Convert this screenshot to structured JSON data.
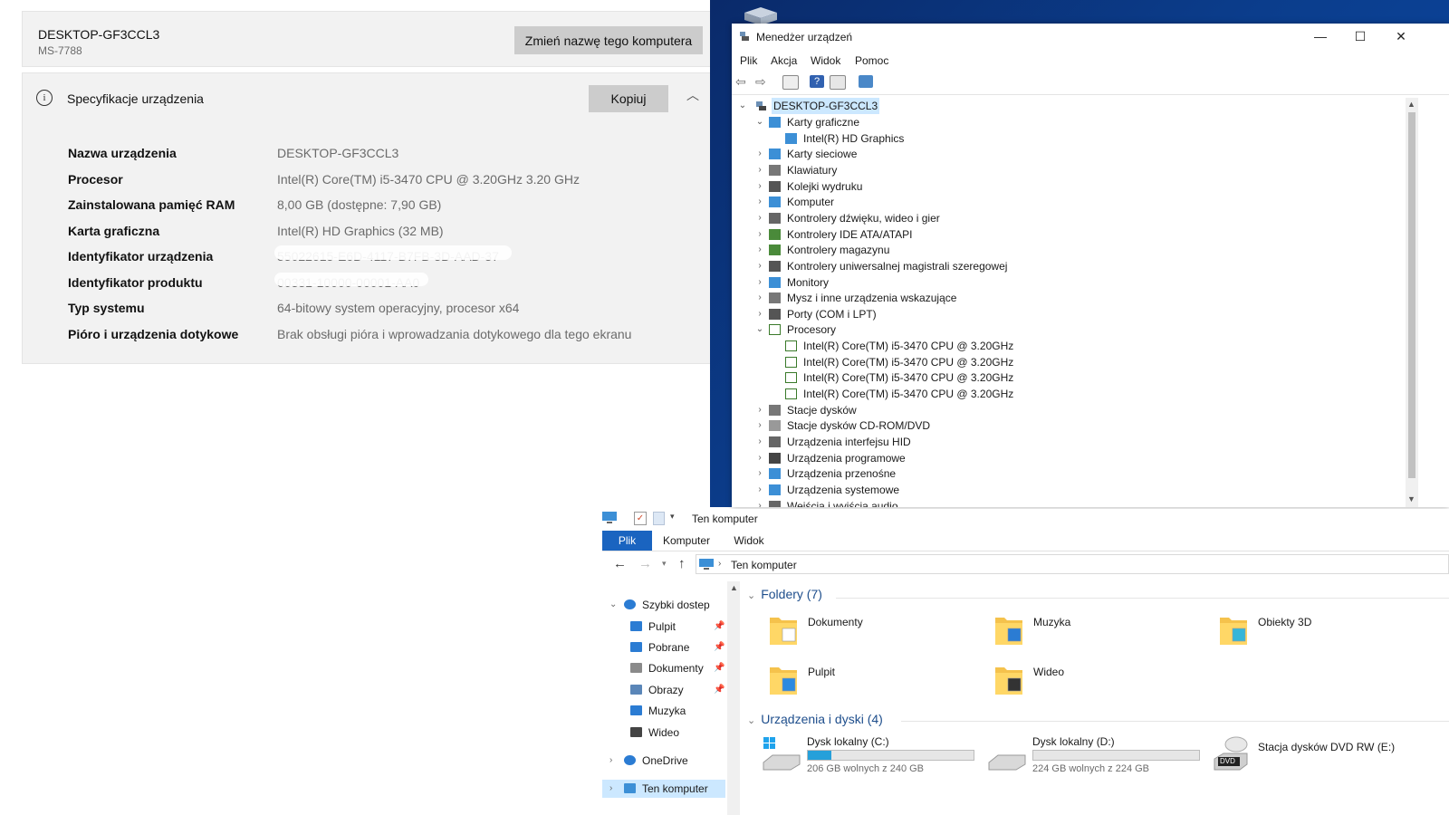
{
  "about": {
    "device_name": "DESKTOP-GF3CCL3",
    "model": "MS-7788",
    "rename_button": "Zmień nazwę tego komputera",
    "spec_title": "Specyfikacje urządzenia",
    "copy_button": "Kopiuj",
    "info_icon": "info-icon",
    "specs": [
      {
        "key": "Nazwa urządzenia",
        "value": "DESKTOP-GF3CCL3"
      },
      {
        "key": "Procesor",
        "value": "Intel(R) Core(TM) i5-3470 CPU @ 3.20GHz   3.20 GHz"
      },
      {
        "key": "Zainstalowana pamięć RAM",
        "value": "8,00 GB (dostępne: 7,90 GB)"
      },
      {
        "key": "Karta graficzna",
        "value": "Intel(R) HD Graphics (32 MB)"
      },
      {
        "key": "Identyfikator urządzenia",
        "value": "55022615-E6D-4117-B7FB-3D-AAD-37"
      },
      {
        "key": "Identyfikator produktu",
        "value": "00331-10000-00001-AA0"
      },
      {
        "key": "Typ systemu",
        "value": "64-bitowy system operacyjny, procesor x64"
      },
      {
        "key": "Pióro i urządzenia dotykowe",
        "value": "Brak obsługi pióra i wprowadzania dotykowego dla tego ekranu"
      }
    ]
  },
  "devmgr": {
    "title": "Menedżer urządzeń",
    "menu": [
      "Plik",
      "Akcja",
      "Widok",
      "Pomoc"
    ],
    "window_controls": [
      "—",
      "☐",
      "✕"
    ],
    "root": "DESKTOP-GF3CCL3",
    "tree": [
      {
        "label": "Karty graficzne",
        "level": 1,
        "expanded": true,
        "icon": "display-adapter-icon",
        "color": "#3c8fd6"
      },
      {
        "label": "Intel(R) HD Graphics",
        "level": 2,
        "icon": "display-adapter-icon",
        "color": "#3c8fd6"
      },
      {
        "label": "Karty sieciowe",
        "level": 1,
        "expanded": false,
        "icon": "network-adapter-icon",
        "color": "#3c8fd6"
      },
      {
        "label": "Klawiatury",
        "level": 1,
        "expanded": false,
        "icon": "keyboard-icon",
        "color": "#777777"
      },
      {
        "label": "Kolejki wydruku",
        "level": 1,
        "expanded": false,
        "icon": "printer-icon",
        "color": "#555555"
      },
      {
        "label": "Komputer",
        "level": 1,
        "expanded": false,
        "icon": "computer-icon",
        "color": "#3c8fd6"
      },
      {
        "label": "Kontrolery dźwięku, wideo i gier",
        "level": 1,
        "expanded": false,
        "icon": "speaker-icon",
        "color": "#666666"
      },
      {
        "label": "Kontrolery IDE ATA/ATAPI",
        "level": 1,
        "expanded": false,
        "icon": "ide-controller-icon",
        "color": "#4a8a3a"
      },
      {
        "label": "Kontrolery magazynu",
        "level": 1,
        "expanded": false,
        "icon": "storage-controller-icon",
        "color": "#4a8a3a"
      },
      {
        "label": "Kontrolery uniwersalnej magistrali szeregowej",
        "level": 1,
        "expanded": false,
        "icon": "usb-icon",
        "color": "#555555"
      },
      {
        "label": "Monitory",
        "level": 1,
        "expanded": false,
        "icon": "monitor-icon",
        "color": "#3c8fd6"
      },
      {
        "label": "Mysz i inne urządzenia wskazujące",
        "level": 1,
        "expanded": false,
        "icon": "mouse-icon",
        "color": "#777777"
      },
      {
        "label": "Porty (COM i LPT)",
        "level": 1,
        "expanded": false,
        "icon": "port-icon",
        "color": "#555555"
      },
      {
        "label": "Procesory",
        "level": 1,
        "expanded": true,
        "icon": "processor-icon",
        "color": "#3a7a2a"
      },
      {
        "label": "Intel(R) Core(TM) i5-3470 CPU @ 3.20GHz",
        "level": 2,
        "icon": "processor-icon",
        "color": "#3a7a2a"
      },
      {
        "label": "Intel(R) Core(TM) i5-3470 CPU @ 3.20GHz",
        "level": 2,
        "icon": "processor-icon",
        "color": "#3a7a2a"
      },
      {
        "label": "Intel(R) Core(TM) i5-3470 CPU @ 3.20GHz",
        "level": 2,
        "icon": "processor-icon",
        "color": "#3a7a2a"
      },
      {
        "label": "Intel(R) Core(TM) i5-3470 CPU @ 3.20GHz",
        "level": 2,
        "icon": "processor-icon",
        "color": "#3a7a2a"
      },
      {
        "label": "Stacje dysków",
        "level": 1,
        "expanded": false,
        "icon": "disk-drive-icon",
        "color": "#777777"
      },
      {
        "label": "Stacje dysków CD-ROM/DVD",
        "level": 1,
        "expanded": false,
        "icon": "cd-drive-icon",
        "color": "#999999"
      },
      {
        "label": "Urządzenia interfejsu HID",
        "level": 1,
        "expanded": false,
        "icon": "hid-icon",
        "color": "#666666"
      },
      {
        "label": "Urządzenia programowe",
        "level": 1,
        "expanded": false,
        "icon": "software-device-icon",
        "color": "#444444"
      },
      {
        "label": "Urządzenia przenośne",
        "level": 1,
        "expanded": false,
        "icon": "portable-device-icon",
        "color": "#3c8fd6"
      },
      {
        "label": "Urządzenia systemowe",
        "level": 1,
        "expanded": false,
        "icon": "system-device-icon",
        "color": "#3c8fd6"
      },
      {
        "label": "Wejścia i wyjścia audio",
        "level": 1,
        "expanded": false,
        "icon": "audio-io-icon",
        "color": "#666666"
      }
    ]
  },
  "explorer": {
    "title": "Ten komputer",
    "tabs": [
      "Plik",
      "Komputer",
      "Widok"
    ],
    "address": "Ten komputer",
    "nav": [
      {
        "label": "Szybki dostep",
        "level": 0,
        "icon": "star-icon",
        "color": "#2b7cd3",
        "pinned": false,
        "chevron": "v"
      },
      {
        "label": "Pulpit",
        "level": 1,
        "icon": "desktop-icon",
        "color": "#2b7cd3",
        "pinned": true
      },
      {
        "label": "Pobrane",
        "level": 1,
        "icon": "download-icon",
        "color": "#2b7cd3",
        "pinned": true
      },
      {
        "label": "Dokumenty",
        "level": 1,
        "icon": "document-icon",
        "color": "#8a8a8a",
        "pinned": true
      },
      {
        "label": "Obrazy",
        "level": 1,
        "icon": "pictures-icon",
        "color": "#5a86b8",
        "pinned": true
      },
      {
        "label": "Muzyka",
        "level": 1,
        "icon": "music-icon",
        "color": "#2b7cd3",
        "pinned": false
      },
      {
        "label": "Wideo",
        "level": 1,
        "icon": "video-icon",
        "color": "#444444",
        "pinned": false
      },
      {
        "label": "OneDrive",
        "level": 0,
        "icon": "cloud-icon",
        "color": "#2b7cd3",
        "pinned": false,
        "chevron": ">"
      },
      {
        "label": "Ten komputer",
        "level": 0,
        "icon": "computer-icon",
        "color": "#3c8fd6",
        "pinned": false,
        "chevron": ">",
        "selected": true
      }
    ],
    "folders_header": "Foldery (7)",
    "folders": [
      {
        "label": "Dokumenty",
        "icon": "documents-folder-icon",
        "accent": "#ffffff"
      },
      {
        "label": "Muzyka",
        "icon": "music-folder-icon",
        "accent": "#2b7cd3"
      },
      {
        "label": "Obiekty 3D",
        "icon": "3d-objects-folder-icon",
        "accent": "#36b6d8"
      },
      {
        "label": "Pulpit",
        "icon": "desktop-folder-icon",
        "accent": "#2b8ae0"
      },
      {
        "label": "Wideo",
        "icon": "video-folder-icon",
        "accent": "#333333"
      }
    ],
    "drives_header": "Urządzenia i dyski (4)",
    "drives": [
      {
        "label": "Dysk lokalny (C:)",
        "free": "206 GB wolnych z 240 GB",
        "used_fraction": 0.14,
        "icon": "windows-drive-icon"
      },
      {
        "label": "Dysk lokalny (D:)",
        "free": "224 GB wolnych z 224 GB",
        "used_fraction": 0.0,
        "icon": "hard-drive-icon"
      },
      {
        "label": "Stacja dysków DVD RW (E:)",
        "icon": "dvd-drive-icon",
        "badge": "DVD"
      }
    ]
  }
}
